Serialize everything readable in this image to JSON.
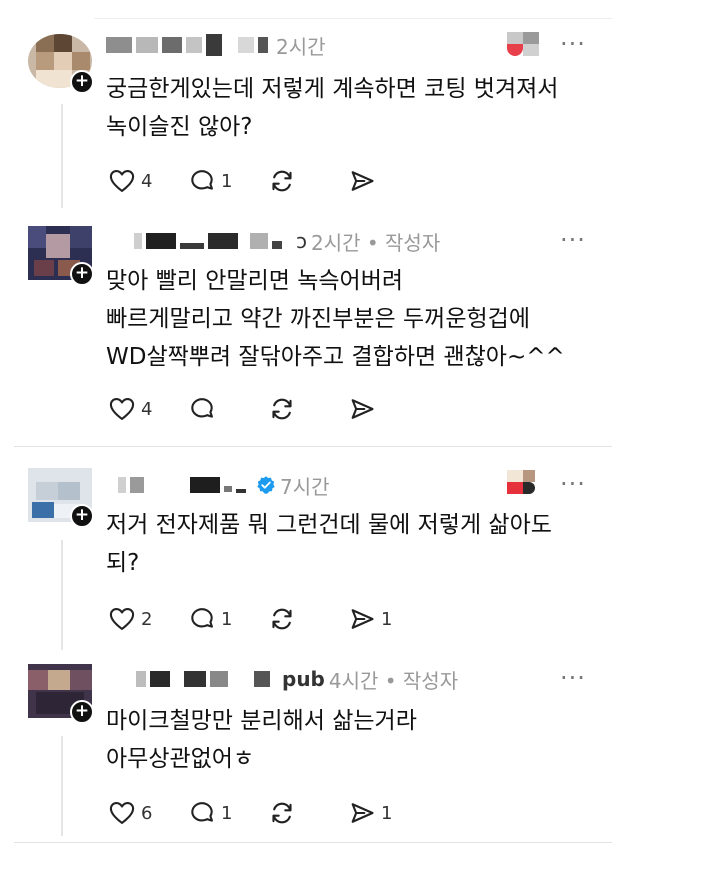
{
  "comments": [
    {
      "time": "2시간",
      "author_tag": "",
      "author_suffix": "",
      "lines": [
        "궁금한게있는데 저렇게 계속하면 코팅 벗겨져서",
        "녹이슬진 않아?"
      ],
      "likes": "4",
      "replies": "1",
      "shares": ""
    },
    {
      "time": "2시간 • 작성자",
      "author_tag": "",
      "author_suffix": "ɔ",
      "lines": [
        "맞아 빨리 안말리면 녹슥어버려",
        "빠르게말리고 약간 까진부분은 두꺼운헝겁에",
        "WD살짝뿌려 잘닦아주고 결합하면 괜찮아~^^"
      ],
      "likes": "4",
      "replies": "",
      "shares": ""
    },
    {
      "time": "7시간",
      "author_tag": "",
      "author_suffix": "",
      "lines": [
        "저거 전자제품 뭐 그런건데 물에 저렇게 삶아도",
        "되?"
      ],
      "likes": "2",
      "replies": "1",
      "shares": "1"
    },
    {
      "time": "4시간 • 작성자",
      "author_tag": "",
      "author_suffix": "pub",
      "lines": [
        "마이크철망만 분리해서 삶는거라",
        "아무상관없어ㅎ"
      ],
      "likes": "6",
      "replies": "1",
      "shares": "1"
    }
  ],
  "icons": {
    "like": "heart-icon",
    "reply": "speech-bubble-icon",
    "repost": "repost-icon",
    "share": "send-icon",
    "more": "more-dots-icon",
    "verified": "verified-badge-icon",
    "follow": "plus-icon"
  },
  "colors": {
    "verified": "#1d9bf0",
    "meta": "#999999",
    "text": "#111111"
  },
  "more_symbol": "···",
  "plus_symbol": "+"
}
